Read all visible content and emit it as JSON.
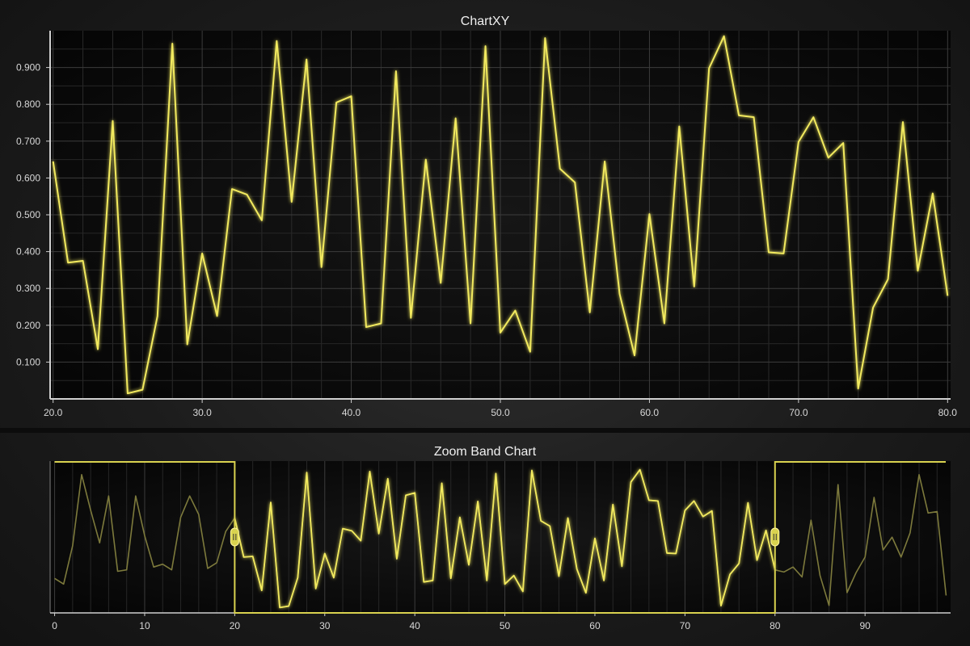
{
  "colors": {
    "series": "#f2ea5e",
    "series_dim": "#7d7a3c",
    "band": "#d9d24f",
    "grid": "#3c3c3c",
    "axis": "#cfcfcf"
  },
  "chart_data": [
    {
      "type": "line",
      "title": "ChartXY",
      "xlabel": "",
      "ylabel": "",
      "xlim": [
        19.8,
        80.2
      ],
      "ylim": [
        0.0,
        1.0
      ],
      "xticks": [
        "20.0",
        "30.0",
        "40.0",
        "50.0",
        "60.0",
        "70.0",
        "80.0"
      ],
      "yticks": [
        "0.100",
        "0.200",
        "0.300",
        "0.400",
        "0.500",
        "0.600",
        "0.700",
        "0.800",
        "0.900"
      ],
      "grid": true,
      "series": [
        {
          "x": [
            20,
            21,
            22,
            23,
            24,
            25,
            26,
            27,
            28,
            29,
            30,
            31,
            32,
            33,
            34,
            35,
            36,
            37,
            38,
            39,
            40,
            41,
            42,
            43,
            44,
            45,
            46,
            47,
            48,
            49,
            50,
            51,
            52,
            53,
            54,
            55,
            56,
            57,
            58,
            59,
            60,
            61,
            62,
            63,
            64,
            65,
            66,
            67,
            68,
            69,
            70,
            71,
            72,
            73,
            74,
            75,
            76,
            77,
            78,
            79,
            80
          ],
          "y": [
            0.645,
            0.37,
            0.375,
            0.135,
            0.755,
            0.015,
            0.025,
            0.225,
            0.965,
            0.148,
            0.395,
            0.225,
            0.57,
            0.555,
            0.485,
            0.972,
            0.535,
            0.922,
            0.358,
            0.805,
            0.822,
            0.195,
            0.205,
            0.89,
            0.22,
            0.65,
            0.315,
            0.762,
            0.205,
            0.958,
            0.18,
            0.24,
            0.128,
            0.98,
            0.625,
            0.588,
            0.235,
            0.645,
            0.285,
            0.118,
            0.502,
            0.205,
            0.74,
            0.305,
            0.898,
            0.985,
            0.77,
            0.765,
            0.398,
            0.395,
            0.698,
            0.765,
            0.655,
            0.695,
            0.028,
            0.248,
            0.325,
            0.752,
            0.348,
            0.558,
            0.28
          ]
        }
      ]
    },
    {
      "type": "line",
      "title": "Zoom Band Chart",
      "xlabel": "",
      "ylabel": "",
      "xlim": [
        -0.5,
        99.5
      ],
      "ylim": [
        0.0,
        1.0
      ],
      "xticks": [
        "0",
        "10",
        "20",
        "30",
        "40",
        "50",
        "60",
        "70",
        "80",
        "90"
      ],
      "grid": true,
      "band": [
        20,
        80
      ],
      "series": [
        {
          "x": [
            0,
            1,
            2,
            3,
            4,
            5,
            6,
            7,
            8,
            9,
            10,
            11,
            12,
            13,
            14,
            15,
            16,
            17,
            18,
            19,
            20,
            21,
            22,
            23,
            24,
            25,
            26,
            27,
            28,
            29,
            30,
            31,
            32,
            33,
            34,
            35,
            36,
            37,
            38,
            39,
            40,
            41,
            42,
            43,
            44,
            45,
            46,
            47,
            48,
            49,
            50,
            51,
            52,
            53,
            54,
            55,
            56,
            57,
            58,
            59,
            60,
            61,
            62,
            63,
            64,
            65,
            66,
            67,
            68,
            69,
            70,
            71,
            72,
            73,
            74,
            75,
            76,
            77,
            78,
            79,
            80,
            81,
            82,
            83,
            84,
            85,
            86,
            87,
            88,
            89,
            90,
            91,
            92,
            93,
            94,
            95,
            96,
            97,
            98,
            99
          ],
          "y": [
            0.22,
            0.18,
            0.45,
            0.95,
            0.7,
            0.47,
            0.8,
            0.27,
            0.28,
            0.8,
            0.52,
            0.3,
            0.32,
            0.28,
            0.65,
            0.8,
            0.67,
            0.29,
            0.33,
            0.55,
            0.645,
            0.37,
            0.375,
            0.135,
            0.755,
            0.015,
            0.025,
            0.225,
            0.965,
            0.148,
            0.395,
            0.225,
            0.57,
            0.555,
            0.485,
            0.972,
            0.535,
            0.922,
            0.358,
            0.805,
            0.822,
            0.195,
            0.205,
            0.89,
            0.22,
            0.65,
            0.315,
            0.762,
            0.205,
            0.958,
            0.18,
            0.24,
            0.128,
            0.98,
            0.625,
            0.588,
            0.235,
            0.645,
            0.285,
            0.118,
            0.502,
            0.205,
            0.74,
            0.305,
            0.898,
            0.985,
            0.77,
            0.765,
            0.398,
            0.395,
            0.698,
            0.765,
            0.655,
            0.695,
            0.028,
            0.248,
            0.325,
            0.752,
            0.348,
            0.558,
            0.28,
            0.265,
            0.3,
            0.23,
            0.63,
            0.24,
            0.03,
            0.88,
            0.12,
            0.26,
            0.37,
            0.79,
            0.42,
            0.51,
            0.37,
            0.54,
            0.95,
            0.68,
            0.69,
            0.1
          ]
        }
      ]
    }
  ]
}
